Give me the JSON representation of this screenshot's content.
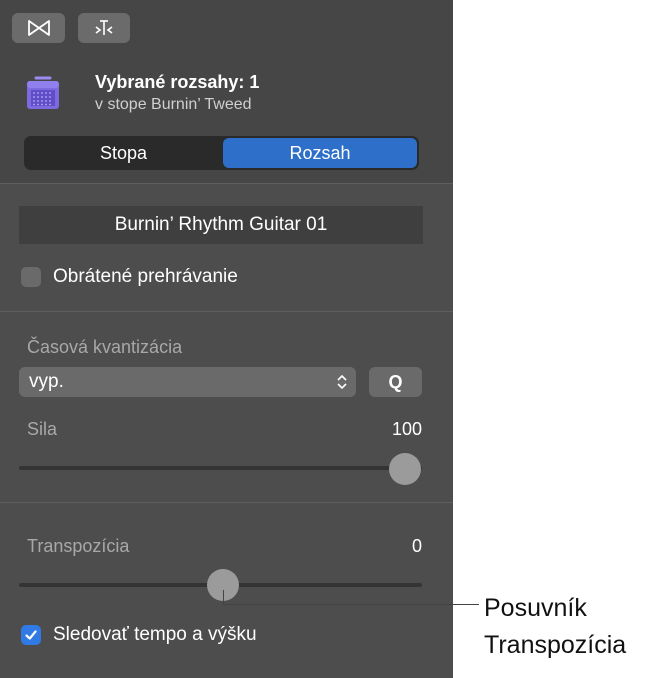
{
  "toolbar": {
    "buttons": [
      {
        "icon": "bowtie-icon"
      },
      {
        "icon": "split-marker-icon"
      }
    ]
  },
  "header": {
    "icon": "amp-icon",
    "title": "Vybrané rozsahy: 1",
    "subtitle": "v stope Burnin’ Tweed"
  },
  "segmented": {
    "left_label": "Stopa",
    "right_label": "Rozsah",
    "selected": "Rozsah"
  },
  "region": {
    "name": "Burnin’ Rhythm Guitar 01",
    "reverse_label": "Obrátené prehrávanie",
    "reverse_checked": false
  },
  "quantize": {
    "label": "Časová kvantizácia",
    "value": "vyp.",
    "q_label": "Q",
    "strength_label": "Sila",
    "strength_value": "100",
    "strength_fraction": 1.0
  },
  "transpose": {
    "label": "Transpozícia",
    "value": "0",
    "fraction": 0.5,
    "follow_label": "Sledovať tempo a výšku",
    "follow_checked": true
  },
  "callout": {
    "line1": "Posuvník",
    "line2": "Transpozícia"
  },
  "colors": {
    "accent": "#2d6fc9",
    "checkbox_on": "#2f7ae5"
  }
}
